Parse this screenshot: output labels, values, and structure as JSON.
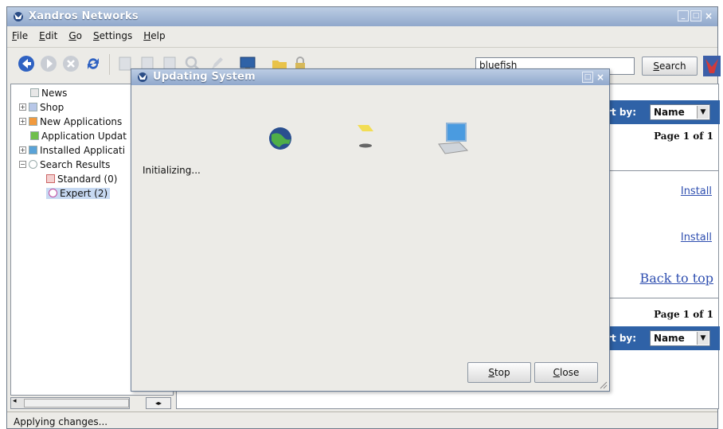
{
  "window": {
    "title": "Xandros Networks"
  },
  "menu": [
    {
      "first": "F",
      "rest": "ile"
    },
    {
      "first": "E",
      "rest": "dit"
    },
    {
      "first": "G",
      "rest": "o"
    },
    {
      "first": "S",
      "rest": "ettings"
    },
    {
      "first": "H",
      "rest": "elp"
    }
  ],
  "toolbar": {
    "search_value": "bluefish",
    "search_first": "S",
    "search_rest": "earch"
  },
  "tree": {
    "items": [
      {
        "label": "News"
      },
      {
        "label": "Shop"
      },
      {
        "label": "New Applications"
      },
      {
        "label": "Application Updat"
      },
      {
        "label": "Installed Applicati"
      },
      {
        "label": "Search Results"
      },
      {
        "label": "Standard (0)"
      },
      {
        "label": "Expert (2)"
      }
    ]
  },
  "content": {
    "sort_label": "rt by:",
    "sort_value": "Name",
    "page_info": "Page 1 of 1",
    "install_1": "Install",
    "install_2": "Install",
    "back_to_top": "Back to top",
    "page_info_2": "Page 1 of 1",
    "sort_label_2": "rt by:",
    "sort_value_2": "Name"
  },
  "status": {
    "text": "Applying changes..."
  },
  "dialog": {
    "title": "Updating System",
    "status": "Initializing...",
    "stop_first": "S",
    "stop_rest": "top",
    "close_first": "C",
    "close_rest": "lose"
  },
  "colors": {
    "accent": "#2f62a7",
    "titlebar": "#9fb4d6",
    "link": "#2f4fb0"
  }
}
